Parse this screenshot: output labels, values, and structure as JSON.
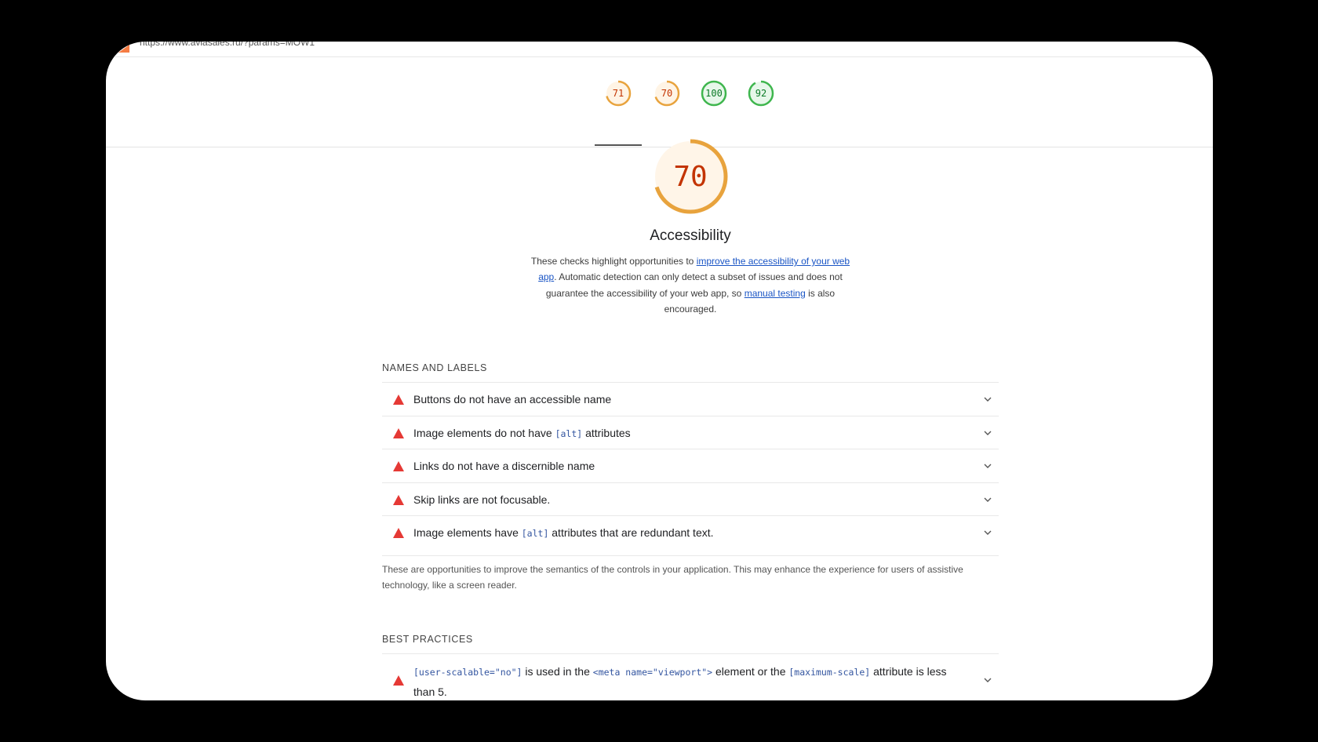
{
  "browser": {
    "url": "https://www.aviasales.ru/?params=MOW1"
  },
  "score_tabs": [
    {
      "score": "71",
      "color": "#e8a33d",
      "fraction": 0.71,
      "text_color": "#c33300"
    },
    {
      "score": "70",
      "color": "#e8a33d",
      "fraction": 0.7,
      "text_color": "#c33300"
    },
    {
      "score": "100",
      "color": "#3fb64e",
      "fraction": 1.0,
      "text_color": "#0b7a26"
    },
    {
      "score": "92",
      "color": "#3fb64e",
      "fraction": 0.92,
      "text_color": "#0b7a26"
    }
  ],
  "category": {
    "score": "70",
    "fraction": 0.7,
    "gauge_color": "#e8a33d",
    "title": "Accessibility",
    "desc_part1": "These checks highlight opportunities to ",
    "desc_link1": "improve the accessibility of your web app",
    "desc_part2": ". Automatic detection can only detect a subset of issues and does not guarantee the accessibility of your web app, so ",
    "desc_link2": "manual testing",
    "desc_part3": " is also encouraged."
  },
  "groups": {
    "names_labels": {
      "title": "NAMES AND LABELS",
      "audits": [
        {
          "pre": "Buttons do not have an accessible name",
          "code": "",
          "post": ""
        },
        {
          "pre": "Image elements do not have ",
          "code": "[alt]",
          "post": " attributes"
        },
        {
          "pre": "Links do not have a discernible name",
          "code": "",
          "post": ""
        },
        {
          "pre": "Skip links are not focusable.",
          "code": "",
          "post": ""
        },
        {
          "pre": "Image elements have ",
          "code": "[alt]",
          "post": " attributes that are redundant text."
        }
      ],
      "description": "These are opportunities to improve the semantics of the controls in your application. This may enhance the experience for users of assistive technology, like a screen reader."
    },
    "best_practices": {
      "title": "BEST PRACTICES",
      "audit": {
        "code1": "[user-scalable=\"no\"]",
        "text1": " is used in the ",
        "code2": "<meta name=\"viewport\">",
        "text2": " element or the ",
        "code3": "[maximum-scale]",
        "text3": " attribute is less than 5."
      }
    }
  },
  "icons": {
    "warning": "warning-triangle-icon",
    "chevron": "chevron-down-icon"
  },
  "colors": {
    "warn": "#e53935",
    "link": "#1a55c5",
    "code": "#3355a0"
  }
}
